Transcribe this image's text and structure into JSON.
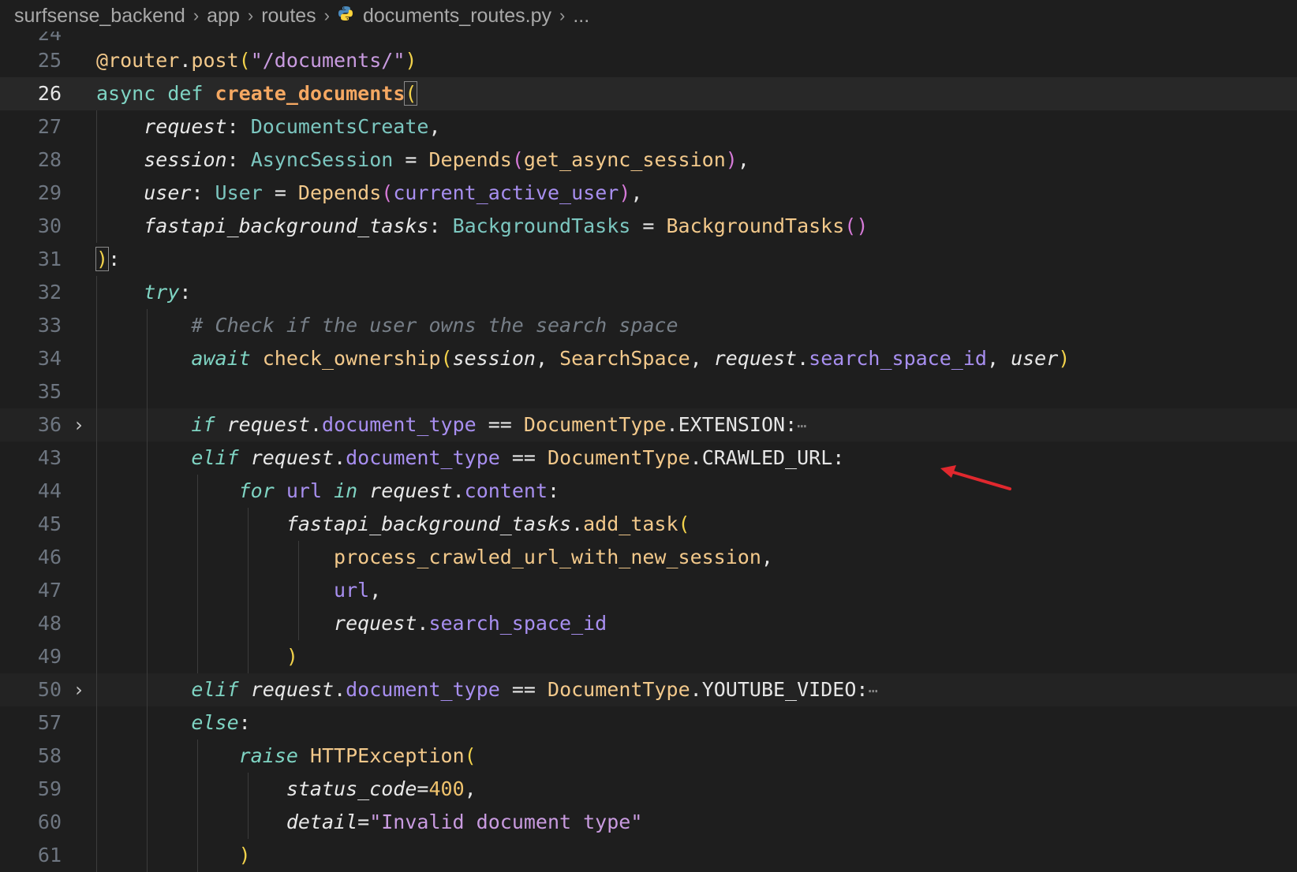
{
  "breadcrumb": {
    "items": [
      "surfsense_backend",
      "app",
      "routes",
      "documents_routes.py",
      "..."
    ]
  },
  "editor": {
    "current_line": "26",
    "line_numbers": [
      "25",
      "26",
      "27",
      "28",
      "29",
      "30",
      "31",
      "32",
      "33",
      "34",
      "35",
      "36",
      "43",
      "44",
      "45",
      "46",
      "47",
      "48",
      "49",
      "50",
      "57",
      "58",
      "59",
      "60",
      "61"
    ],
    "code": {
      "l25_decorator": "@router",
      "l25_method": "post",
      "l25_path": "\"/documents/\"",
      "l26_kw_async": "async",
      "l26_kw_def": "def",
      "l26_name": "create_documents",
      "l27_param": "request",
      "l27_type": "DocumentsCreate",
      "l28_param": "session",
      "l28_type": "AsyncSession",
      "l28_fn": "Depends",
      "l28_arg": "get_async_session",
      "l29_param": "user",
      "l29_type": "User",
      "l29_fn": "Depends",
      "l29_arg": "current_active_user",
      "l30_param": "fastapi_background_tasks",
      "l30_type": "BackgroundTasks",
      "l30_fn": "BackgroundTasks",
      "l32_kw": "try",
      "l33_comment": "# Check if the user owns the search space",
      "l34_await": "await",
      "l34_fn": "check_ownership",
      "l34_a1": "session",
      "l34_a2": "SearchSpace",
      "l34_a3": "request",
      "l34_a3_attr": "search_space_id",
      "l34_a4": "user",
      "l36_if": "if",
      "l36_obj": "request",
      "l36_attr": "document_type",
      "l36_cls": "DocumentType",
      "l36_const": "EXTENSION",
      "l43_elif": "elif",
      "l43_obj": "request",
      "l43_attr": "document_type",
      "l43_cls": "DocumentType",
      "l43_const": "CRAWLED_URL",
      "l44_for": "for",
      "l44_var": "url",
      "l44_in": "in",
      "l44_obj": "request",
      "l44_attr": "content",
      "l45_obj": "fastapi_background_tasks",
      "l45_fn": "add_task",
      "l46_fn": "process_crawled_url_with_new_session",
      "l47_var": "url",
      "l48_obj": "request",
      "l48_attr": "search_space_id",
      "l50_elif": "elif",
      "l50_obj": "request",
      "l50_attr": "document_type",
      "l50_cls": "DocumentType",
      "l50_const": "YOUTUBE_VIDEO",
      "l57_else": "else",
      "l58_raise": "raise",
      "l58_fn": "HTTPException",
      "l59_param": "status_code",
      "l59_val": "400",
      "l60_param": "detail",
      "l60_val": "\"Invalid document type\""
    },
    "folded_ellipsis": "⋯",
    "fold_icon": "chevron-right-icon"
  },
  "annotation": {
    "arrow_color": "#e0282e"
  }
}
